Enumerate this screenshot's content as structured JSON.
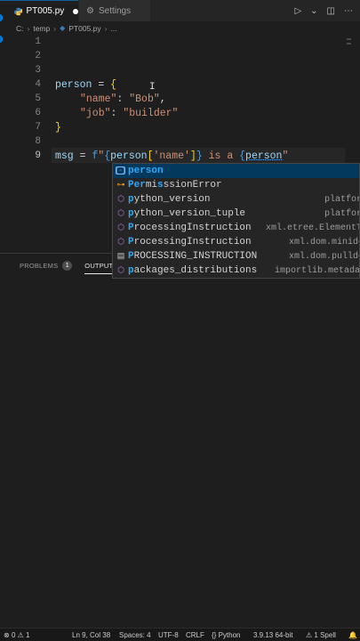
{
  "tabs": [
    {
      "label": "PT005.py",
      "active": true,
      "modified": true
    },
    {
      "label": "Settings",
      "active": false
    }
  ],
  "breadcrumb": [
    "C:",
    "temp",
    "PT005.py",
    "..."
  ],
  "editor": {
    "line_numbers": [
      "1",
      "2",
      "3",
      "4",
      "5",
      "6",
      "7",
      "8",
      "9"
    ],
    "lines": {
      "l4": {
        "var": "person",
        "op": " = ",
        "brace": "{"
      },
      "l5": {
        "key": "\"name\"",
        "colon": ": ",
        "val": "\"Bob\"",
        "comma": ","
      },
      "l6": {
        "key": "\"job\"",
        "colon": ": ",
        "val": "\"builder\""
      },
      "l7": {
        "brace": "}"
      },
      "l9": {
        "var": "msg",
        "op": " = ",
        "prefix": "f",
        "s1": "\"",
        "b1": "{",
        "v1": "person",
        "i1": "[",
        "k1": "'name'",
        "i2": "]",
        "b2": "}",
        "mid": " is a ",
        "b3": "{",
        "v2": "person",
        "s2": "\""
      }
    }
  },
  "suggestions": [
    {
      "icon": "variable-icon",
      "label_hl": "person",
      "label_rest": "",
      "detail": "",
      "selected": true
    },
    {
      "icon": "class-icon",
      "label_hl": "Per",
      "label_mid": "mi",
      "label_rest": "ssionError",
      "detail": ""
    },
    {
      "icon": "module-icon",
      "label_hl": "p",
      "label_rest": "ython_version",
      "detail": "platform"
    },
    {
      "icon": "module-icon",
      "label_hl": "p",
      "label_rest": "ython_version_tuple",
      "detail": "platform"
    },
    {
      "icon": "module-icon",
      "label_hl": "P",
      "label_rest": "rocessingInstruction",
      "detail": "xml.etree.ElementT…"
    },
    {
      "icon": "class-icon",
      "label_hl": "P",
      "label_rest": "rocessingInstruction",
      "detail": "xml.dom.minidom"
    },
    {
      "icon": "text-icon",
      "label_hl": "P",
      "label_rest": "ROCESSING_INSTRUCTION",
      "detail": "xml.dom.pulldom"
    },
    {
      "icon": "module-icon",
      "label_hl": "p",
      "label_rest": "ackages_distributions",
      "detail": "importlib.metadata"
    }
  ],
  "panel": {
    "problems_label": "PROBLEMS",
    "problems_count": "1",
    "output_label": "OUTPUT"
  },
  "status": {
    "errors": "0",
    "warnings": "1",
    "position": "Ln 9, Col 38",
    "spaces": "Spaces: 4",
    "encoding": "UTF-8",
    "eol": "CRLF",
    "language": "Python",
    "interpreter": "3.9.13 64-bit",
    "spell": "1 Spell"
  },
  "colors": {
    "editor_bg": "#1e1e1e",
    "variable": "#9cdcfe",
    "string": "#ce9178",
    "suggest_highlight": "#2aaaff",
    "selected_row": "#04395e"
  }
}
